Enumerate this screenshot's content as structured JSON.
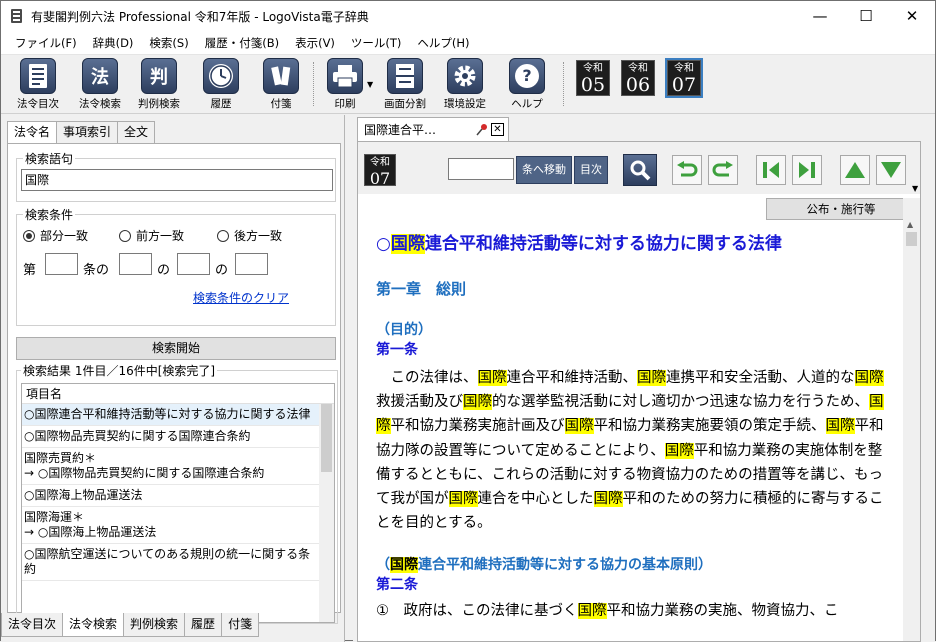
{
  "window": {
    "title": "有斐閣判例六法 Professional 令和7年版 - LogoVista電子辞典",
    "minimize": "—",
    "maximize": "☐",
    "close": "✕"
  },
  "menu": [
    "ファイル(F)",
    "辞典(D)",
    "検索(S)",
    "履歴・付箋(B)",
    "表示(V)",
    "ツール(T)",
    "ヘルプ(H)"
  ],
  "toolbar": {
    "buttons": [
      {
        "label": "法令目次",
        "icon": "list-icon"
      },
      {
        "label": "法令検索",
        "icon": "law-search-icon",
        "glyph": "法"
      },
      {
        "label": "判例検索",
        "icon": "case-search-icon",
        "glyph": "判"
      },
      {
        "label": "履歴",
        "icon": "clock-icon"
      },
      {
        "label": "付箋",
        "icon": "sticky-note-icon"
      },
      {
        "label": "印刷",
        "icon": "printer-icon"
      },
      {
        "label": "画面分割",
        "icon": "split-screen-icon"
      },
      {
        "label": "環境設定",
        "icon": "gear-icon"
      },
      {
        "label": "ヘルプ",
        "icon": "help-icon",
        "glyph": "?"
      }
    ],
    "eras": [
      {
        "top": "令和",
        "num": "05"
      },
      {
        "top": "令和",
        "num": "06"
      },
      {
        "top": "令和",
        "num": "07"
      }
    ]
  },
  "left": {
    "tabs": [
      "法令名",
      "事項索引",
      "全文"
    ],
    "search_term_label": "検索語句",
    "search_term_value": "国際",
    "conditions_label": "検索条件",
    "radios": [
      {
        "label": "部分一致",
        "checked": true
      },
      {
        "label": "前方一致",
        "checked": false
      },
      {
        "label": "後方一致",
        "checked": false
      }
    ],
    "article_labels": [
      "第",
      "条の",
      "の",
      "の"
    ],
    "clear_link": "検索条件のクリア",
    "search_button": "検索開始",
    "results_label": "検索結果 1件目／16件中[検索完了]",
    "list_header": "項目名",
    "results": [
      "○国際連合平和維持活動等に対する協力に関する法律",
      "○国際物品売買契約に関する国際連合条約",
      "国際売買約＊\n→ ○国際物品売買契約に関する国際連合条約",
      "○国際海上物品運送法",
      "国際海運＊\n→ ○国際海上物品運送法",
      "○国際航空運送についてのある規則の統一に関する条約"
    ],
    "bottom_tabs": [
      "法令目次",
      "法令検索",
      "判例検索",
      "履歴",
      "付箋"
    ]
  },
  "doc": {
    "tab_label": "国際連合平…",
    "era_top": "令和",
    "era_num": "07",
    "goto_button": "条へ移動",
    "toc_button": "目次",
    "pub_button": "公布・施行等",
    "title_marker": "○",
    "title_hl": "国際",
    "title_rest": "連合平和維持活動等に対する協力に関する法律",
    "chapter": "第一章　総則",
    "purpose": "（目的）",
    "art1": "第一条",
    "para1": [
      {
        "t": "この法律は、"
      },
      {
        "t": "国際",
        "h": true
      },
      {
        "t": "連合平和維持活動、"
      },
      {
        "t": "国際",
        "h": true
      },
      {
        "t": "連携平和安全活動、人道的な"
      },
      {
        "t": "国際",
        "h": true
      },
      {
        "t": "救援活動及び"
      },
      {
        "t": "国際",
        "h": true
      },
      {
        "t": "的な選挙監視活動に対し適切かつ迅速な協力を行うため、"
      },
      {
        "t": "国際",
        "h": true
      },
      {
        "t": "平和協力業務実施計画及び"
      },
      {
        "t": "国際",
        "h": true
      },
      {
        "t": "平和協力業務実施要領の策定手続、"
      },
      {
        "t": "国際",
        "h": true
      },
      {
        "t": "平和協力隊の設置等について定めることにより、"
      },
      {
        "t": "国際",
        "h": true
      },
      {
        "t": "平和協力業務の実施体制を整備するとともに、これらの活動に対する物資協力のための措置等を講じ、もって我が国が"
      },
      {
        "t": "国際",
        "h": true
      },
      {
        "t": "連合を中心とした"
      },
      {
        "t": "国際",
        "h": true
      },
      {
        "t": "平和のための努力に積極的に寄与することを目的とする。"
      }
    ],
    "principle_open": "（",
    "principle_hl": "国際",
    "principle_rest": "連合平和維持活動等に対する協力の基本原則）",
    "art2": "第二条",
    "para2_pre": "①　政府は、この法律に基づく",
    "para2_hl": "国際",
    "para2_post": "平和協力業務の実施、物資協力、こ"
  }
}
